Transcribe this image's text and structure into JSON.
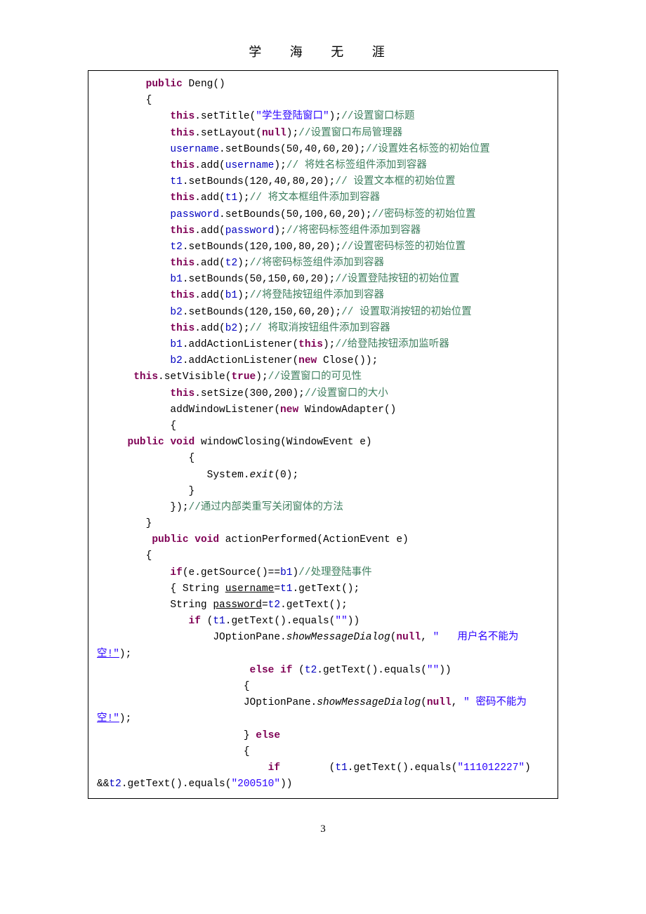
{
  "header": "学 海 无 涯",
  "pagenum": "3",
  "code": {
    "l01a": "public",
    "l01b": " Deng()",
    "l02": "        {",
    "l03a": "this",
    "l03b": ".setTitle(",
    "l03c": "\"学生登陆窗口\"",
    "l03d": ");",
    "l03e": "//设置窗口标题",
    "l04a": "this",
    "l04b": ".setLayout(",
    "l04c": "null",
    "l04d": ");",
    "l04e": "//设置窗口布局管理器",
    "l05a": "username",
    "l05b": ".setBounds(50,40,60,20);",
    "l05c": "//设置姓名标签的初始位置",
    "l06a": "this",
    "l06b": ".add(",
    "l06c": "username",
    "l06d": ");",
    "l06e": "// 将姓名标签组件添加到容器",
    "l07a": "t1",
    "l07b": ".setBounds(120,40,80,20);",
    "l07c": "// 设置文本框的初始位置",
    "l08a": "this",
    "l08b": ".add(",
    "l08c": "t1",
    "l08d": ");",
    "l08e": "// 将文本框组件添加到容器",
    "l09a": "password",
    "l09b": ".setBounds(50,100,60,20);",
    "l09c": "//密码标签的初始位置",
    "l10a": "this",
    "l10b": ".add(",
    "l10c": "password",
    "l10d": ");",
    "l10e": "//将密码标签组件添加到容器",
    "l11a": "t2",
    "l11b": ".setBounds(120,100,80,20);",
    "l11c": "//设置密码标签的初始位置",
    "l12a": "this",
    "l12b": ".add(",
    "l12c": "t2",
    "l12d": ");",
    "l12e": "//将密码标签组件添加到容器",
    "l13a": "b1",
    "l13b": ".setBounds(50,150,60,20);",
    "l13c": "//设置登陆按钮的初始位置",
    "l14a": "this",
    "l14b": ".add(",
    "l14c": "b1",
    "l14d": ");",
    "l14e": "//将登陆按钮组件添加到容器",
    "l15a": "b2",
    "l15b": ".setBounds(120,150,60,20);",
    "l15c": "// 设置取消按钮的初始位置",
    "l16a": "this",
    "l16b": ".add(",
    "l16c": "b2",
    "l16d": ");",
    "l16e": "// 将取消按钮组件添加到容器",
    "l17a": "b1",
    "l17b": ".addActionListener(",
    "l17c": "this",
    "l17d": ");",
    "l17e": "//给登陆按钮添加监听器",
    "l18a": "b2",
    "l18b": ".addActionListener(",
    "l18c": "new",
    "l18d": " Close());",
    "l19a": "this",
    "l19b": ".setVisible(",
    "l19c": "true",
    "l19d": ");",
    "l19e": "//设置窗口的可见性",
    "l20a": "this",
    "l20b": ".setSize(300,200);",
    "l20c": "//设置窗口的大小",
    "l21a": "            addWindowListener(",
    "l21b": "new",
    "l21c": " WindowAdapter()",
    "l22": "            {",
    "l23a": "public",
    "l23b": " ",
    "l23c": "void",
    "l23d": " windowClosing(WindowEvent e)",
    "l24": "               {",
    "l25a": "                  System.",
    "l25b": "exit",
    "l25c": "(0);",
    "l26": "               }",
    "l27a": "            });",
    "l27b": "//通过内部类重写关闭窗体的方法",
    "l28": "        }",
    "l29a": "public",
    "l29b": " ",
    "l29c": "void",
    "l29d": " actionPerformed(ActionEvent e)",
    "l30": "        {",
    "l31a": "if",
    "l31b": "(e.getSource()==",
    "l31c": "b1",
    "l31d": ")",
    "l31e": "//处理登陆事件",
    "l32a": "            { String ",
    "l32b": "username",
    "l32c": "=",
    "l32d": "t1",
    "l32e": ".getText();",
    "l33a": "            String ",
    "l33b": "password",
    "l33c": "=",
    "l33d": "t2",
    "l33e": ".getText();",
    "l34a": "if",
    "l34b": " (",
    "l34c": "t1",
    "l34d": ".getText().equals(",
    "l34e": "\"\"",
    "l34f": "))",
    "l35a": "                   JOptionPane.",
    "l35b": "showMessageDialog",
    "l35c": "(",
    "l35d": "null",
    "l35e": ", ",
    "l35f": "\"   用户名不能为",
    "l35g": "空!\"",
    "l35h": ");",
    "l36a": "else",
    "l36b": " ",
    "l36c": "if",
    "l36d": " (",
    "l36e": "t2",
    "l36f": ".getText().equals(",
    "l36g": "\"\"",
    "l36h": "))",
    "l37": "                        {",
    "l38a": "                        JOptionPane.",
    "l38b": "showMessageDialog",
    "l38c": "(",
    "l38d": "null",
    "l38e": ", ",
    "l38f": "\" 密码不能为",
    "l38g": "空!\"",
    "l38h": ");",
    "l39a": "                        } ",
    "l39b": "else",
    "l40": "                        {",
    "l41a": "if",
    "l41b": "        (",
    "l41c": "t1",
    "l41d": ".getText().equals(",
    "l41e": "\"111012227\"",
    "l41f": ")",
    "l42a": "&&",
    "l42b": "t2",
    "l42c": ".getText().equals(",
    "l42d": "\"200510\"",
    "l42e": "))"
  }
}
